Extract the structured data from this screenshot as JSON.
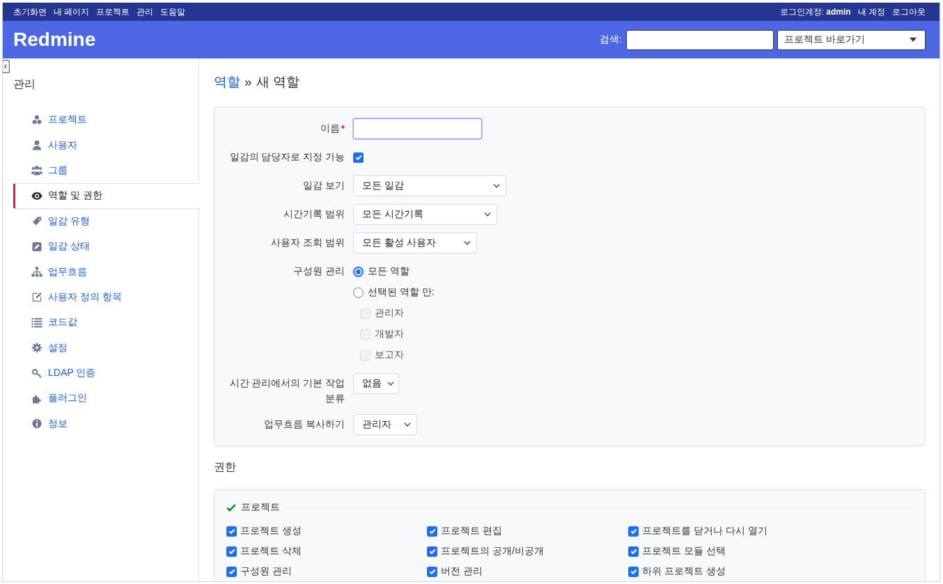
{
  "top_menu": {
    "items": [
      "초기화면",
      "내 페이지",
      "프로젝트",
      "관리",
      "도움말"
    ],
    "logged_in": "로그인계정: **admin**",
    "account_links": [
      "내 계정",
      "로그아웃"
    ]
  },
  "header": {
    "title": "Redmine",
    "search_label": "검색:",
    "project_jump": "프로젝트 바로가기"
  },
  "sidebar": {
    "title": "관리",
    "items": [
      {
        "label": "프로젝트",
        "selected": false
      },
      {
        "label": "사용자",
        "selected": false
      },
      {
        "label": "그룹",
        "selected": false
      },
      {
        "label": "역할 및 권한",
        "selected": true
      },
      {
        "label": "일감 유형",
        "selected": false
      },
      {
        "label": "일감 상태",
        "selected": false
      },
      {
        "label": "업무흐름",
        "selected": false
      },
      {
        "label": "사용자 정의 항목",
        "selected": false
      },
      {
        "label": "코드값",
        "selected": false
      },
      {
        "label": "설정",
        "selected": false
      },
      {
        "label": "LDAP 인증",
        "selected": false
      },
      {
        "label": "플러그인",
        "selected": false
      },
      {
        "label": "정보",
        "selected": false
      }
    ]
  },
  "breadcrumb": {
    "parent": "역할",
    "separator": "»",
    "current": "새 역할"
  },
  "form": {
    "fields": [
      {
        "kind": "text",
        "label": "이름",
        "required_mark": "*",
        "focused": true
      },
      {
        "kind": "checkbox",
        "label": "일감의 담당자로 지정 가능",
        "checked": true
      },
      {
        "kind": "select",
        "label": "일감 보기",
        "value": "모든 일감"
      },
      {
        "kind": "select",
        "label": "시간기록 범위",
        "value": "모든 시간기록"
      },
      {
        "kind": "select",
        "label": "사용자 조회 범위",
        "value": "모든 활성 사용자"
      },
      {
        "kind": "radio_group",
        "label": "구성원 관리",
        "options": [
          {
            "label": "모든 역할",
            "selected": true
          },
          {
            "label": "선택된 역할 만:",
            "selected": false
          }
        ],
        "roles": [
          {
            "label": "관리자",
            "checked": false,
            "disabled": true
          },
          {
            "label": "개발자",
            "checked": false,
            "disabled": true
          },
          {
            "label": "보고자",
            "checked": false,
            "disabled": true
          }
        ]
      },
      {
        "kind": "select",
        "label": "시간 관리에서의 기본 작업 분류",
        "value": "없음"
      },
      {
        "kind": "select",
        "label": "업무흐름 복사하기",
        "value": "관리자"
      }
    ]
  },
  "permissions": {
    "title": "권한",
    "groups": [
      {
        "legend": "프로젝트",
        "items": [
          {
            "label": "프로젝트 생성",
            "checked": true
          },
          {
            "label": "프로젝트 편집",
            "checked": true
          },
          {
            "label": "프로젝트를 닫거나 다시 열기",
            "checked": true
          },
          {
            "label": "프로젝트 삭제",
            "checked": true
          },
          {
            "label": "프로젝트의 공개/비공개",
            "checked": true
          },
          {
            "label": "프로젝트 모듈 선택",
            "checked": true
          },
          {
            "label": "구성원 관리",
            "checked": true
          },
          {
            "label": "버전 관리",
            "checked": true
          },
          {
            "label": "하위 프로젝트 생성",
            "checked": true
          }
        ]
      }
    ]
  }
}
